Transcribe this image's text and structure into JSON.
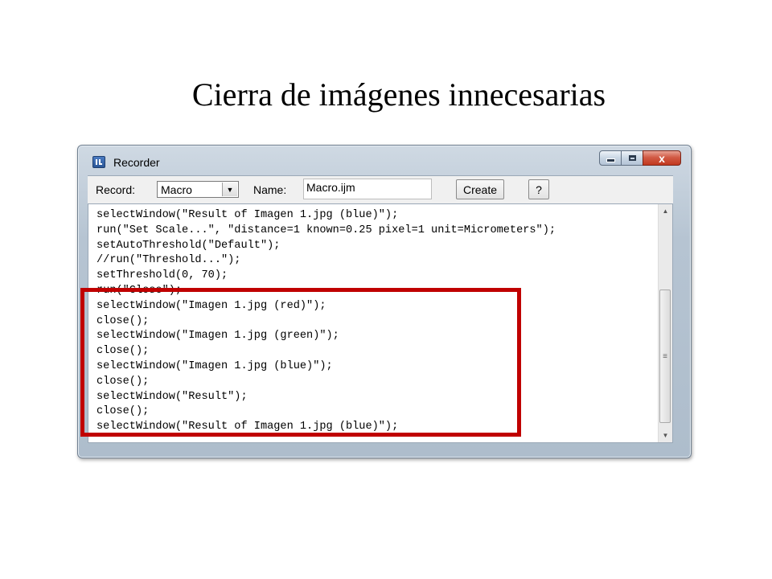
{
  "slide": {
    "title": "Cierra de imágenes innecesarias"
  },
  "window": {
    "title": "Recorder",
    "icon": "imagej-icon",
    "controls": {
      "minimize": "minimize-icon",
      "maximize": "maximize-icon",
      "close": "x"
    }
  },
  "toolbar": {
    "record_label": "Record:",
    "record_value": "Macro",
    "name_label": "Name:",
    "name_value": "Macro.ijm",
    "create_label": "Create",
    "help_label": "?"
  },
  "editor": {
    "lines": [
      "selectWindow(\"Result of Imagen 1.jpg (blue)\");",
      "run(\"Set Scale...\", \"distance=1 known=0.25 pixel=1 unit=Micrometers\");",
      "setAutoThreshold(\"Default\");",
      "//run(\"Threshold...\");",
      "setThreshold(0, 70);",
      "run(\"Close\");",
      "selectWindow(\"Imagen 1.jpg (red)\");",
      "close();",
      "selectWindow(\"Imagen 1.jpg (green)\");",
      "close();",
      "selectWindow(\"Imagen 1.jpg (blue)\");",
      "close();",
      "selectWindow(\"Result\");",
      "close();",
      "selectWindow(\"Result of Imagen 1.jpg (blue)\");"
    ]
  },
  "colors": {
    "highlight": "#c00000",
    "close_button": "#c1391f"
  }
}
